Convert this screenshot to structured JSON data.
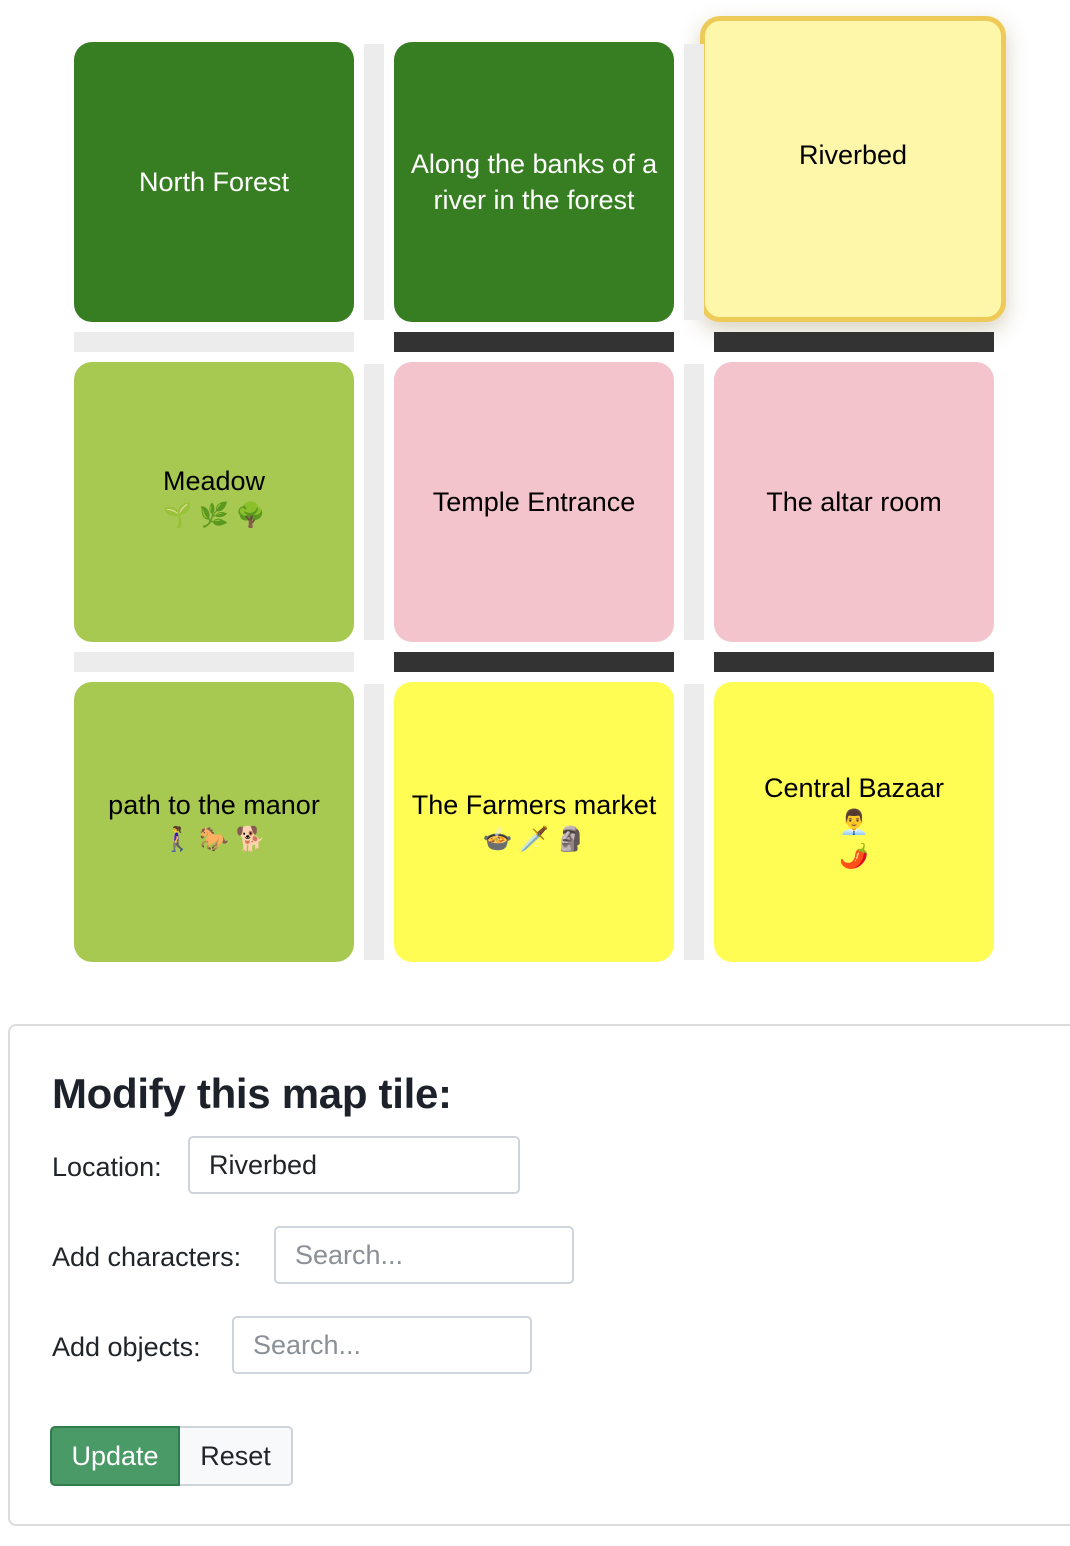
{
  "map": {
    "tiles": [
      {
        "name": "North Forest",
        "emojis": "",
        "bg": "#377e22",
        "fg": "#ffffff",
        "selected": false
      },
      {
        "name": "Along the banks of a river in the forest",
        "emojis": "",
        "bg": "#377e22",
        "fg": "#ffffff",
        "selected": false
      },
      {
        "name": "Riverbed",
        "emojis": "",
        "bg": "#fef6a9",
        "fg": "#000000",
        "selected": true
      },
      {
        "name": "Meadow",
        "emojis": "🌱 🌿 🌳",
        "bg": "#a7c951",
        "fg": "#000000",
        "selected": false
      },
      {
        "name": "Temple Entrance",
        "emojis": "",
        "bg": "#f4c4cc",
        "fg": "#000000",
        "selected": false
      },
      {
        "name": "The altar room",
        "emojis": "",
        "bg": "#f4c4cc",
        "fg": "#000000",
        "selected": false
      },
      {
        "name": "path to the manor",
        "emojis": "🚶‍♀️ 🐎 🐕",
        "bg": "#a7c951",
        "fg": "#000000",
        "selected": false
      },
      {
        "name": "The Farmers market",
        "emojis": "🍲 🗡️ 🗿",
        "bg": "#fffd54",
        "fg": "#000000",
        "selected": false
      },
      {
        "name": "Central Bazaar",
        "emojis": "👨‍💼\n🌶️",
        "bg": "#fffd54",
        "fg": "#000000",
        "selected": false
      }
    ],
    "connectors": {
      "open_color": "#ececec",
      "closed_color": "#333333",
      "horizontal": [
        "open",
        "closed",
        "closed",
        "open",
        "closed",
        "closed"
      ],
      "vertical": [
        "open",
        "open",
        "open",
        "open",
        "open",
        "open"
      ]
    }
  },
  "form": {
    "title": "Modify this map tile:",
    "location_label": "Location:",
    "location_value": "Riverbed",
    "characters_label": "Add characters:",
    "characters_placeholder": "Search...",
    "objects_label": "Add objects:",
    "objects_placeholder": "Search...",
    "update_label": "Update",
    "reset_label": "Reset"
  }
}
